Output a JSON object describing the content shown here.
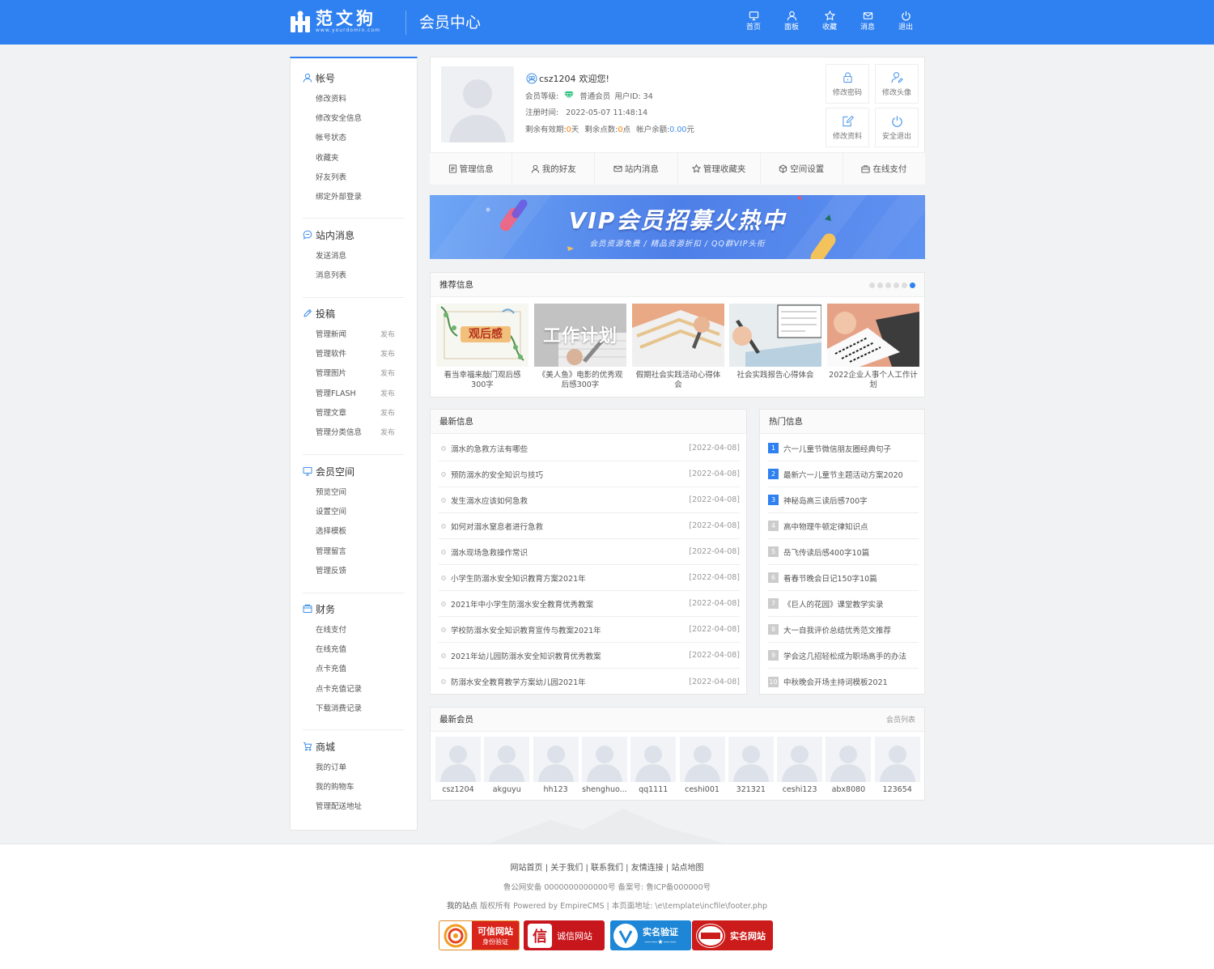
{
  "header": {
    "logo_text": "范文狗",
    "logo_domain": "www.yourdomin.com",
    "title": "会员中心",
    "nav": [
      {
        "label": "首页",
        "icon": "monitor-icon"
      },
      {
        "label": "面板",
        "icon": "user-icon"
      },
      {
        "label": "收藏",
        "icon": "star-icon"
      },
      {
        "label": "消息",
        "icon": "mail-icon"
      },
      {
        "label": "退出",
        "icon": "power-icon"
      }
    ]
  },
  "sidebar": {
    "groups": [
      {
        "title": "帐号",
        "icon": "user-icon",
        "items": [
          "修改资料",
          "修改安全信息",
          "帐号状态",
          "收藏夹",
          "好友列表",
          "绑定外部登录"
        ]
      },
      {
        "title": "站内消息",
        "icon": "chat-icon",
        "items": [
          "发送消息",
          "消息列表"
        ]
      },
      {
        "title": "投稿",
        "icon": "pen-icon",
        "items": [
          "管理新闻",
          "管理软件",
          "管理图片",
          "管理FLASH",
          "管理文章",
          "管理分类信息"
        ],
        "publish_label": "发布"
      },
      {
        "title": "会员空间",
        "icon": "monitor-icon",
        "items": [
          "预览空间",
          "设置空间",
          "选择模板",
          "管理留言",
          "管理反馈"
        ]
      },
      {
        "title": "财务",
        "icon": "wallet-icon",
        "items": [
          "在线支付",
          "在线充值",
          "点卡充值",
          "点卡充值记录",
          "下载消费记录"
        ]
      },
      {
        "title": "商城",
        "icon": "cart-icon",
        "items": [
          "我的订单",
          "我的购物车",
          "管理配送地址"
        ]
      }
    ]
  },
  "user": {
    "name": "csz1204",
    "welcome": "欢迎您!",
    "level_label": "会员等级:",
    "level": "普通会员",
    "uid_label": "用户ID:",
    "uid": "34",
    "reg_label": "注册时间:",
    "reg_time": "2022-05-07 11:48:14",
    "days_label": "剩余有效期:",
    "days": "0",
    "days_unit": "天",
    "points_label": "剩余点数:",
    "points": "0",
    "points_unit": "点",
    "balance_label": "帐户余额:",
    "balance": "0.00",
    "balance_unit": "元",
    "buttons": [
      {
        "label": "修改密码",
        "icon": "lock-icon"
      },
      {
        "label": "修改头像",
        "icon": "avatar-edit-icon"
      },
      {
        "label": "修改资料",
        "icon": "edit-icon"
      },
      {
        "label": "安全退出",
        "icon": "power-icon"
      }
    ],
    "tabs": [
      {
        "label": "管理信息",
        "icon": "doc-icon"
      },
      {
        "label": "我的好友",
        "icon": "user-icon"
      },
      {
        "label": "站内消息",
        "icon": "mail-icon"
      },
      {
        "label": "管理收藏夹",
        "icon": "star-icon"
      },
      {
        "label": "空间设置",
        "icon": "cube-icon"
      },
      {
        "label": "在线支付",
        "icon": "bag-icon"
      }
    ]
  },
  "banner": {
    "title": "VIP会员招募火热中",
    "subtitle": "会员资源免费 / 精品资源折扣 / QQ群VIP头衔"
  },
  "recommend": {
    "title": "推荐信息",
    "slider": {
      "count": 6,
      "active_index": 5
    },
    "items": [
      {
        "caption": "看当幸福来敲门观后感300字",
        "image_text": "观后感"
      },
      {
        "caption": "《美人鱼》电影的优秀观后感300字",
        "image_text": "工作计划"
      },
      {
        "caption": "假期社会实践活动心得体会"
      },
      {
        "caption": "社会实践报告心得体会"
      },
      {
        "caption": "2022企业人事个人工作计划"
      }
    ]
  },
  "latest": {
    "title": "最新信息",
    "items": [
      {
        "text": "溺水的急救方法有哪些",
        "date": "[2022-04-08]"
      },
      {
        "text": "预防溺水的安全知识与技巧",
        "date": "[2022-04-08]"
      },
      {
        "text": "发生溺水应该如何急救",
        "date": "[2022-04-08]"
      },
      {
        "text": "如何对溺水窒息者进行急救",
        "date": "[2022-04-08]"
      },
      {
        "text": "溺水现场急救操作常识",
        "date": "[2022-04-08]"
      },
      {
        "text": "小学生防溺水安全知识教育方案2021年",
        "date": "[2022-04-08]"
      },
      {
        "text": "2021年中小学生防溺水安全教育优秀教案",
        "date": "[2022-04-08]"
      },
      {
        "text": "学校防溺水安全知识教育宣传与教案2021年",
        "date": "[2022-04-08]"
      },
      {
        "text": "2021年幼儿园防溺水安全知识教育优秀教案",
        "date": "[2022-04-08]"
      },
      {
        "text": "防溺水安全教育教学方案幼儿园2021年",
        "date": "[2022-04-08]"
      }
    ]
  },
  "hot": {
    "title": "热门信息",
    "items": [
      {
        "num": "1",
        "text": "六一儿童节微信朋友圈经典句子"
      },
      {
        "num": "2",
        "text": "最新六一儿童节主题活动方案2020"
      },
      {
        "num": "3",
        "text": "神秘岛高三读后感700字"
      },
      {
        "num": "4",
        "text": "高中物理牛顿定律知识点"
      },
      {
        "num": "5",
        "text": "岳飞传读后感400字10篇"
      },
      {
        "num": "6",
        "text": "看春节晚会日记150字10篇"
      },
      {
        "num": "7",
        "text": "《巨人的花园》课堂教学实录"
      },
      {
        "num": "8",
        "text": "大一自我评价总结优秀范文推荐"
      },
      {
        "num": "9",
        "text": "学会这几招轻松成为职场高手的办法"
      },
      {
        "num": "10",
        "text": "中秋晚会开场主持词模板2021"
      }
    ]
  },
  "members": {
    "title": "最新会员",
    "more": "会员列表",
    "items": [
      "csz1204",
      "akguyu",
      "hh123",
      "shenghuo...",
      "qq1111",
      "ceshi001",
      "321321",
      "ceshi123",
      "abx8080",
      "123654"
    ]
  },
  "footer": {
    "links": [
      "网站首页",
      "关于我们",
      "联系我们",
      "友情连接",
      "站点地图"
    ],
    "icp": "鲁公网安备 0000000000000号 备案号: 鲁ICP备000000号",
    "copy_site": "我的站点",
    "copy_rest": "版权所有 Powered by EmpireCMS | 本页面地址: \\e\\template\\incfile\\footer.php",
    "badges": [
      {
        "label": "可信网站",
        "sub": "身份验证",
        "color": "#d9241c"
      },
      {
        "label": "诚信网站",
        "sub": "",
        "color": "#c8161d"
      },
      {
        "label": "实名验证",
        "sub": "——★——",
        "color": "#1d86d6"
      },
      {
        "label": "实名网站",
        "sub": "",
        "color": "#cc1b1b"
      }
    ]
  },
  "colors": {
    "accent": "#2f80f0",
    "orange": "#ff7a00",
    "link_blue": "#3f8fe8"
  }
}
